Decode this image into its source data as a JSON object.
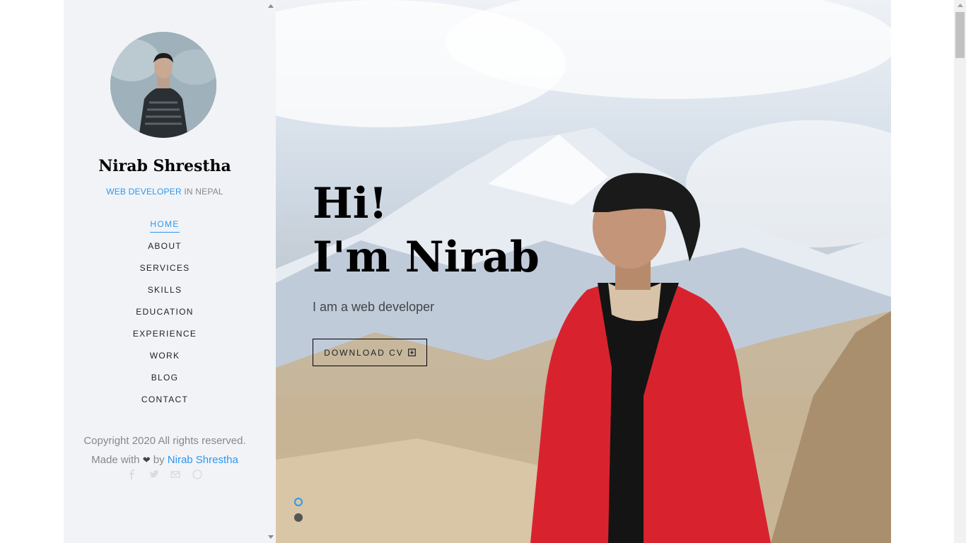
{
  "sidebar": {
    "name": "Nirab Shrestha",
    "role_accent": "WEB DEVELOPER",
    "role_rest": " IN NEPAL",
    "nav": [
      {
        "label": "HOME",
        "active": true
      },
      {
        "label": "ABOUT"
      },
      {
        "label": "SERVICES"
      },
      {
        "label": "SKILLS"
      },
      {
        "label": "EDUCATION"
      },
      {
        "label": "EXPERIENCE"
      },
      {
        "label": "WORK"
      },
      {
        "label": "BLOG"
      },
      {
        "label": "CONTACT"
      }
    ],
    "copyright": "Copyright 2020 All rights reserved.",
    "made_with": "Made with",
    "heart": "❤",
    "by": "by",
    "author": "Nirab Shrestha",
    "socials": [
      "facebook-icon",
      "twitter-icon",
      "mail-icon",
      "github-icon"
    ]
  },
  "hero": {
    "line1": "Hi!",
    "line2": "I'm Nirab",
    "tagline": "I am a web developer",
    "button_label": "DOWNLOAD CV",
    "slides": [
      {
        "active": true
      },
      {
        "active": false
      }
    ]
  },
  "colors": {
    "accent": "#2c98f0",
    "sidebar_bg": "#f2f3f7",
    "jacket": "#d8232f"
  }
}
